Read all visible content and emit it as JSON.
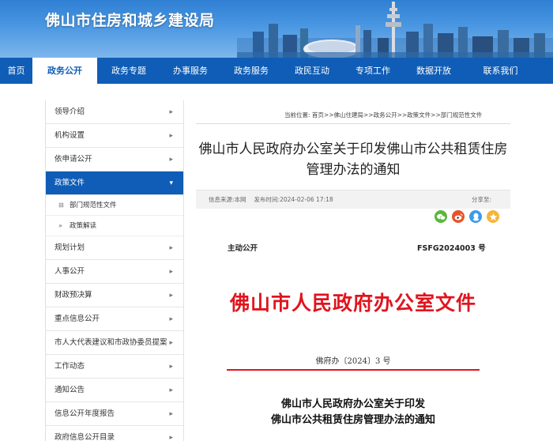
{
  "site": {
    "title": "佛山市住房和城乡建设局"
  },
  "nav": {
    "items": [
      {
        "label": "首页"
      },
      {
        "label": "政务公开"
      },
      {
        "label": "政务专题"
      },
      {
        "label": "办事服务"
      },
      {
        "label": "政务服务"
      },
      {
        "label": "政民互动"
      },
      {
        "label": "专项工作"
      },
      {
        "label": "数据开放"
      },
      {
        "label": "联系我们"
      }
    ],
    "active": "政务公开"
  },
  "sidebar": {
    "items": [
      {
        "label": "领导介绍"
      },
      {
        "label": "机构设置"
      },
      {
        "label": "依申请公开"
      },
      {
        "label": "政策文件"
      },
      {
        "label": "规划计划"
      },
      {
        "label": "人事公开"
      },
      {
        "label": "财政预决算"
      },
      {
        "label": "重点信息公开"
      },
      {
        "label": "市人大代表建议和市政协委员提案"
      },
      {
        "label": "工作动态"
      },
      {
        "label": "通知公告"
      },
      {
        "label": "信息公开年度报告"
      },
      {
        "label": "政府信息公开目录"
      }
    ],
    "subitems": [
      {
        "label": "部门规范性文件",
        "mark": "⊟"
      },
      {
        "label": "政策解读",
        "mark": "»"
      }
    ]
  },
  "breadcrumb": {
    "prefix": "当前位置:",
    "items": [
      "首页",
      "佛山住建局",
      "政务公开",
      "政策文件",
      "部门规范性文件"
    ],
    "separator": ">>"
  },
  "article": {
    "title": "佛山市人民政府办公室关于印发佛山市公共租赁住房管理办法的通知",
    "source_label": "信息来源:",
    "source": "本网",
    "time_label": "发布时间:",
    "time": "2024-02-06 17:18",
    "share_label": "分享至:"
  },
  "document": {
    "open_type": "主动公开",
    "doc_number": "FSFG2024003 号",
    "header": "佛山市人民政府办公室文件",
    "issue": "佛府办〔2024〕3 号",
    "body_title_line1": "佛山市人民政府办公室关于印发",
    "body_title_line2": "佛山市公共租赁住房管理办法的通知"
  },
  "colors": {
    "nav_bg": "#0f5db6",
    "doc_red": "#e0141e",
    "wechat": "#5bb63b",
    "weibo": "#e6532b",
    "qq": "#3c9be8",
    "qzone": "#f5b53b"
  },
  "share_icons": [
    "wechat-icon",
    "weibo-icon",
    "qq-icon",
    "qzone-icon"
  ]
}
